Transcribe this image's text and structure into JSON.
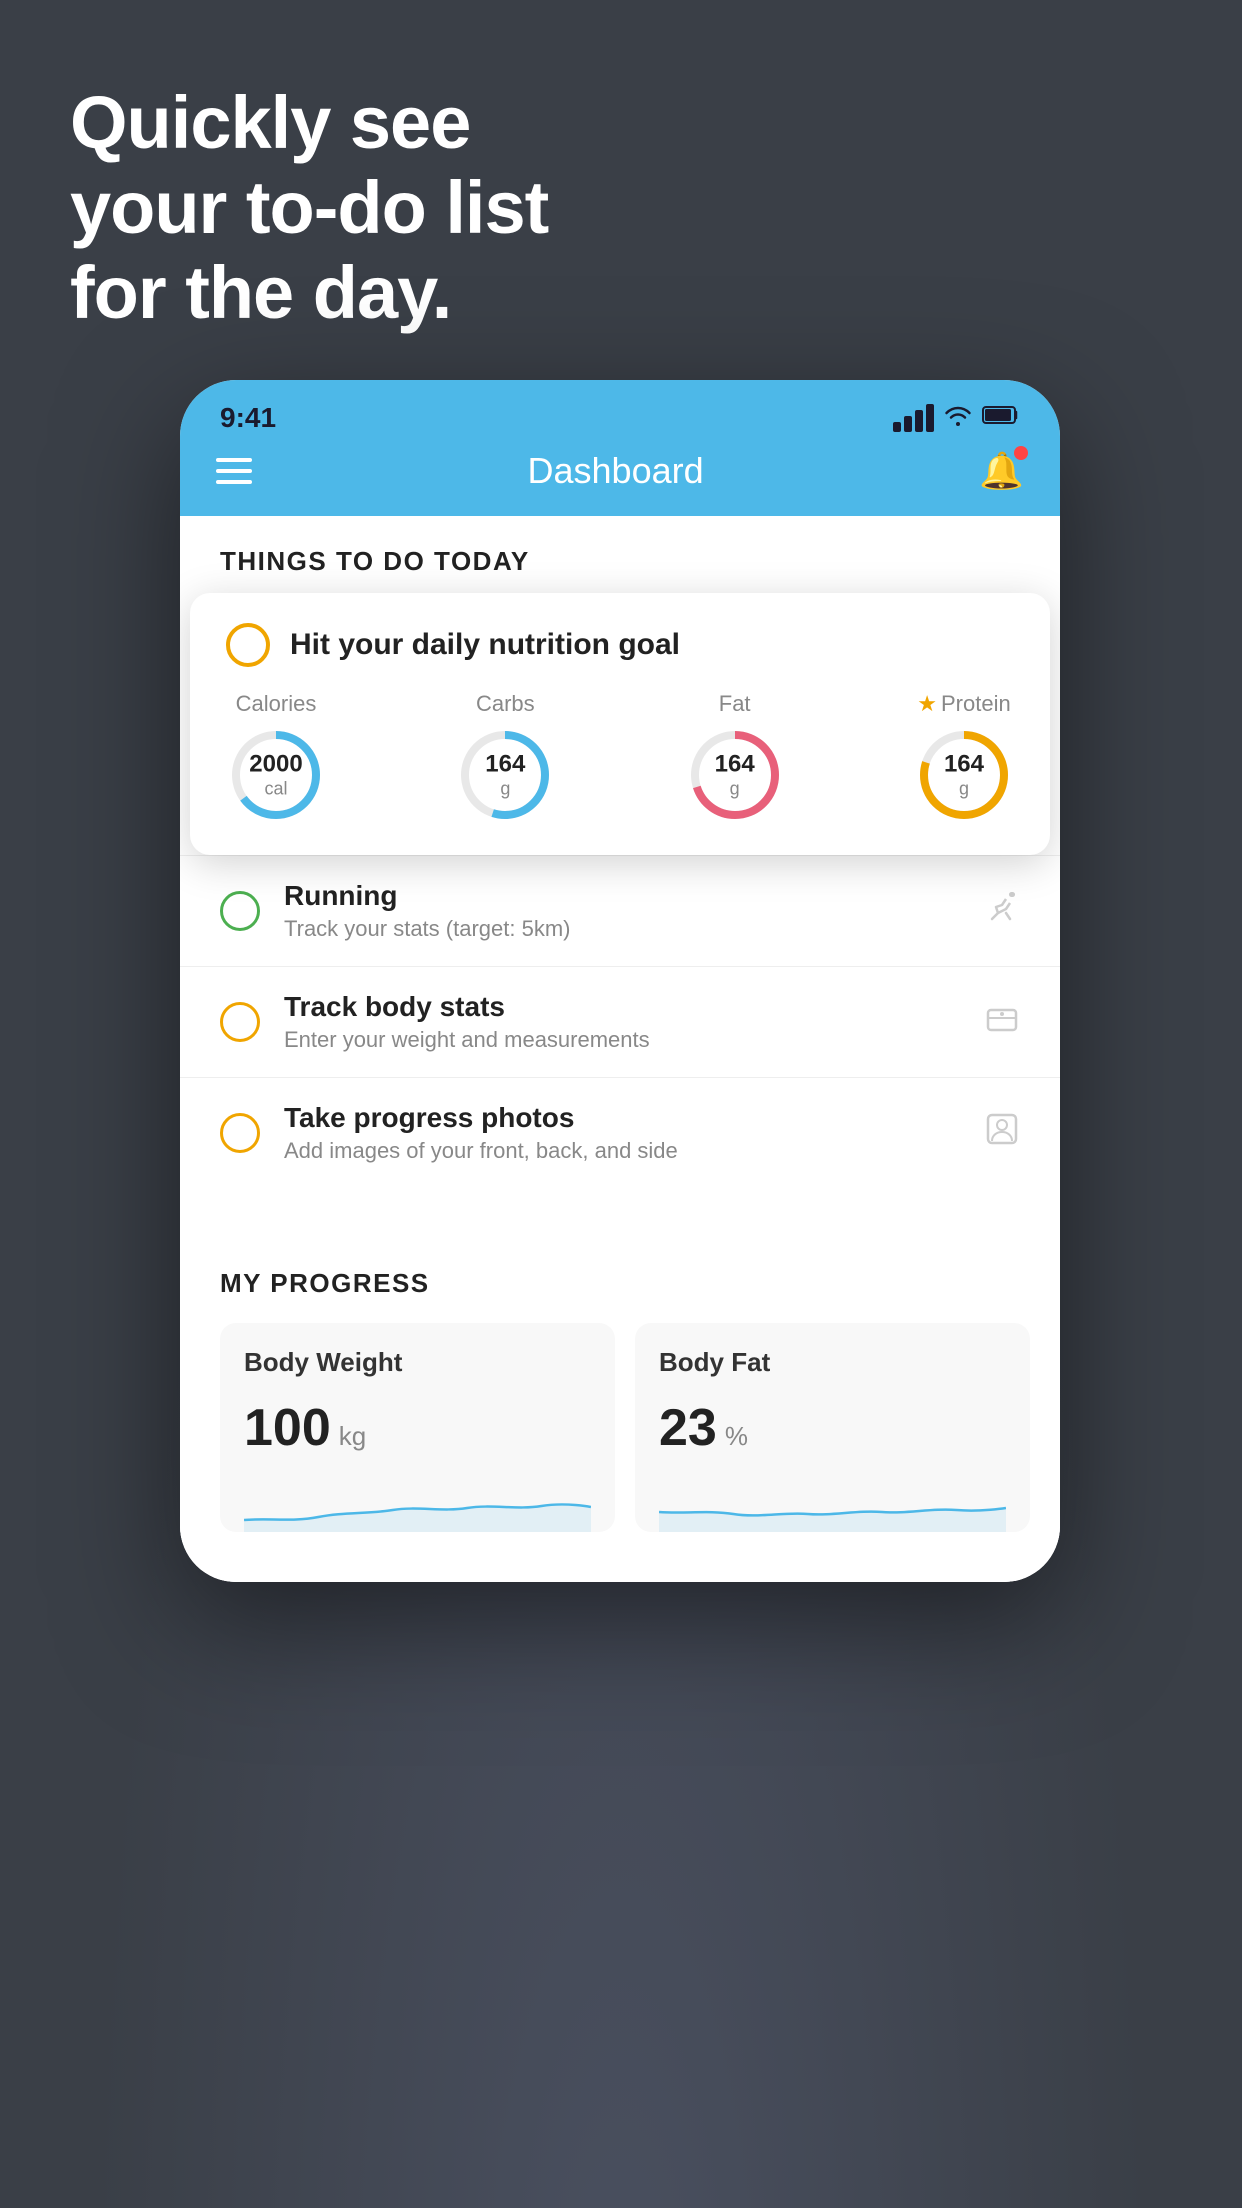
{
  "background": {
    "color": "#3a3f47"
  },
  "hero": {
    "line1": "Quickly see",
    "line2": "your to-do list",
    "line3": "for the day."
  },
  "phone": {
    "statusBar": {
      "time": "9:41",
      "signal": "signal",
      "wifi": "wifi",
      "battery": "battery"
    },
    "navBar": {
      "title": "Dashboard"
    },
    "thingsToday": {
      "sectionTitle": "THINGS TO DO TODAY"
    },
    "nutritionCard": {
      "title": "Hit your daily nutrition goal",
      "macros": [
        {
          "label": "Calories",
          "value": "2000",
          "unit": "cal",
          "color": "#4db8e8",
          "pct": 65
        },
        {
          "label": "Carbs",
          "value": "164",
          "unit": "g",
          "color": "#4db8e8",
          "pct": 55
        },
        {
          "label": "Fat",
          "value": "164",
          "unit": "g",
          "color": "#e8607a",
          "pct": 70
        },
        {
          "label": "Protein",
          "value": "164",
          "unit": "g",
          "color": "#f0a500",
          "pct": 80,
          "starred": true
        }
      ]
    },
    "todoItems": [
      {
        "id": "running",
        "name": "Running",
        "desc": "Track your stats (target: 5km)",
        "circleColor": "green",
        "icon": "👟"
      },
      {
        "id": "body-stats",
        "name": "Track body stats",
        "desc": "Enter your weight and measurements",
        "circleColor": "yellow",
        "icon": "⚖"
      },
      {
        "id": "progress-photos",
        "name": "Take progress photos",
        "desc": "Add images of your front, back, and side",
        "circleColor": "yellow",
        "icon": "👤"
      }
    ],
    "progressSection": {
      "title": "MY PROGRESS",
      "cards": [
        {
          "id": "body-weight",
          "title": "Body Weight",
          "value": "100",
          "unit": "kg"
        },
        {
          "id": "body-fat",
          "title": "Body Fat",
          "value": "23",
          "unit": "%"
        }
      ]
    }
  }
}
